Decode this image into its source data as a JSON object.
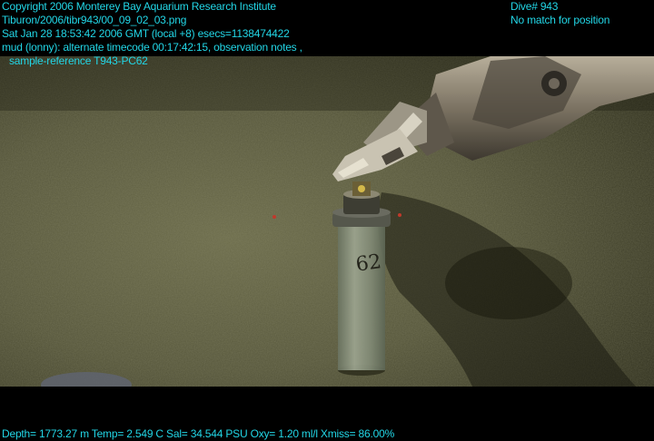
{
  "overlay": {
    "left_lines": [
      "Copyright 2006 Monterey Bay Aquarium Research Institute",
      "Tiburon/2006/tibr943/00_09_02_03.png",
      "Sat Jan 28 18:53:42 2006 GMT (local +8)  esecs=1138474422",
      "mud (lonny): alternate timecode 00:17:42:15, observation notes ,",
      "sample-reference T943-PC62"
    ],
    "right_lines": [
      "Dive# 943",
      "No match for position"
    ],
    "footer": "Depth= 1773.27 m  Temp= 2.549 C  Sal= 34.544 PSU  Oxy= 1.20 ml/l  Xmiss= 86.00%"
  },
  "scene": {
    "description_colors": {
      "sediment": "#55553a",
      "sediment_dark": "#2e2e1c",
      "overlay_text": "#22d6e6",
      "arm_metal": "#8a8070",
      "core_tube": "#9aa08e"
    },
    "core_label": "62"
  }
}
